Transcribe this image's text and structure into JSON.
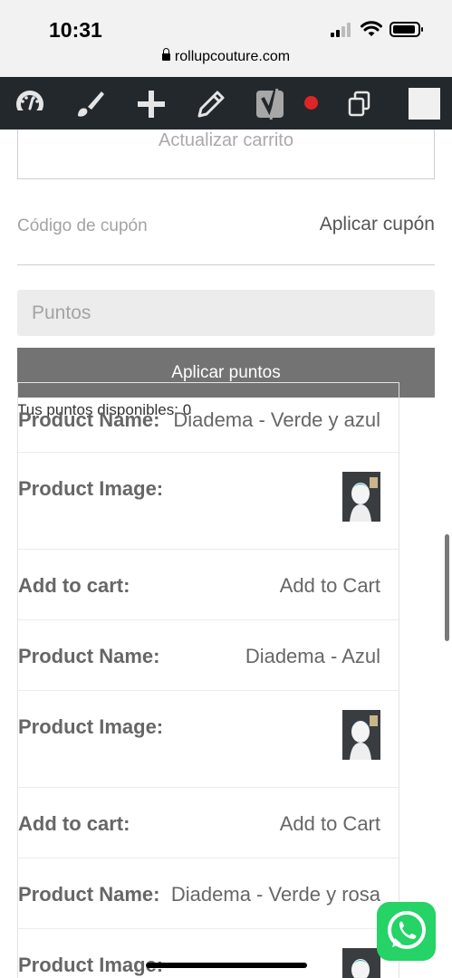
{
  "status": {
    "time": "10:31",
    "url": "rollupcouture.com"
  },
  "admin_bar": {
    "icons": [
      "dashboard-icon",
      "brush-icon",
      "plus-icon",
      "pencil-icon",
      "yoast-icon",
      "record-dot",
      "copy-icon",
      "square-box"
    ]
  },
  "cart": {
    "update_label": "Actualizar carrito"
  },
  "coupon": {
    "placeholder": "Código de cupón",
    "apply_label": "Aplicar cupón"
  },
  "points": {
    "placeholder": "Puntos",
    "apply_label": "Aplicar puntos",
    "available": "Tus puntos disponibles: 0"
  },
  "products": [
    {
      "name_label": "Product Name:",
      "name": "Diadema - Verde y azul",
      "image_label": "Product Image:",
      "cart_label": "Add to cart:",
      "cart_action": "Add to Cart"
    },
    {
      "name_label": "Product Name:",
      "name": "Diadema - Azul",
      "image_label": "Product Image:",
      "cart_label": "Add to cart:",
      "cart_action": "Add to Cart"
    },
    {
      "name_label": "Product Name:",
      "name": "Diadema - Verde y rosa",
      "image_label": "Product Image:"
    }
  ],
  "colors": {
    "admin_bar": "#23282d",
    "record": "#dc2626",
    "whatsapp": "#25d366",
    "button_gray": "#737373"
  }
}
